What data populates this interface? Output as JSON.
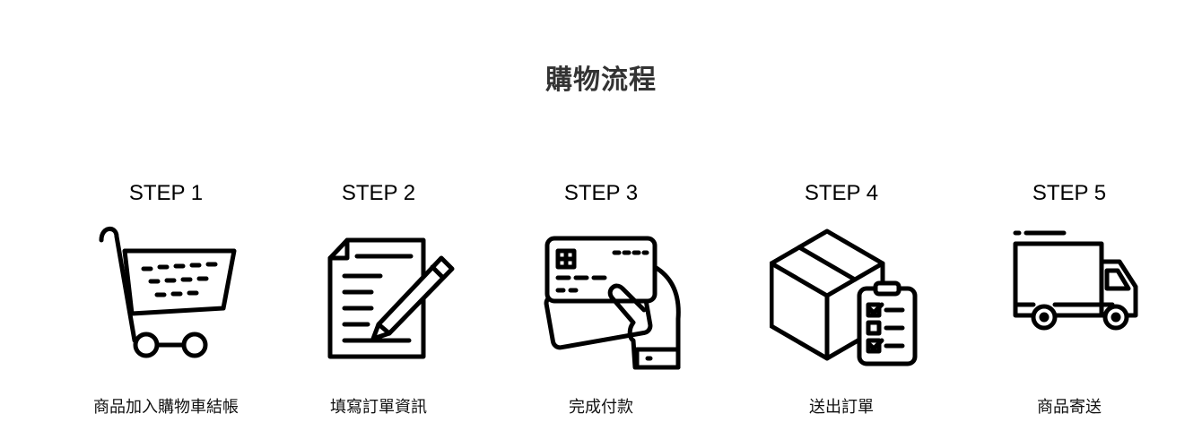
{
  "title": "購物流程",
  "steps": [
    {
      "label": "STEP 1",
      "caption": "商品加入購物車結帳",
      "icon": "shopping-cart-icon"
    },
    {
      "label": "STEP 2",
      "caption": "填寫訂單資訊",
      "icon": "document-pencil-icon"
    },
    {
      "label": "STEP 3",
      "caption": "完成付款",
      "icon": "credit-card-hand-icon"
    },
    {
      "label": "STEP 4",
      "caption": "送出訂單",
      "icon": "box-clipboard-icon"
    },
    {
      "label": "STEP 5",
      "caption": "商品寄送",
      "icon": "delivery-truck-icon"
    }
  ]
}
